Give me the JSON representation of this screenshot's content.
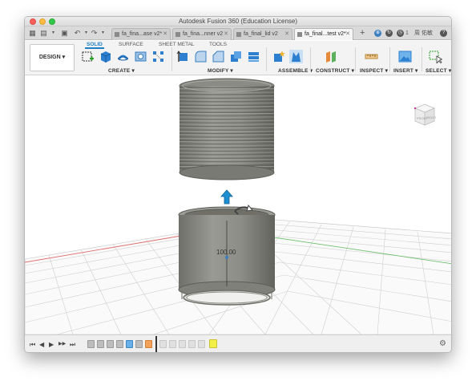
{
  "window": {
    "title": "Autodesk Fusion 360 (Education License)"
  },
  "tabs": [
    {
      "label": "fa_fina...ase v2*",
      "active": false
    },
    {
      "label": "fa_fina...nner v2",
      "active": false
    },
    {
      "label": "fa_final_lid v2",
      "active": false
    },
    {
      "label": "fa_final...test v2*",
      "active": true
    }
  ],
  "topbar": {
    "notifications_count": "1",
    "user_name": "周 佑敏",
    "help_label": "?"
  },
  "toolbar": {
    "workspace_label": "DESIGN ▾",
    "workspace_tabs": [
      {
        "label": "SOLID",
        "active": true
      },
      {
        "label": "SURFACE",
        "active": false
      },
      {
        "label": "SHEET METAL",
        "active": false
      },
      {
        "label": "TOOLS",
        "active": false
      }
    ],
    "groups": [
      {
        "label": "CREATE ▾"
      },
      {
        "label": "MODIFY ▾"
      },
      {
        "label": "ASSEMBLE ▾"
      },
      {
        "label": "CONSTRUCT ▾"
      },
      {
        "label": "INSPECT ▾"
      },
      {
        "label": "INSERT ▾"
      },
      {
        "label": "SELECT ▾"
      }
    ]
  },
  "viewport": {
    "dimension_value": "100.00",
    "viewcube_front": "FRONT",
    "viewcube_right": "RIGHT",
    "colors": {
      "background": "#ffffff",
      "grid": "#c9c9c9",
      "axis_red": "#e05050",
      "axis_green": "#4fb04f",
      "body_metal": "#8a8a84",
      "move_arrow": "#1d8fd1"
    }
  },
  "timeline": {
    "buttons": [
      "⏮",
      "◀",
      "▶",
      "▶▶",
      "⏭"
    ]
  }
}
